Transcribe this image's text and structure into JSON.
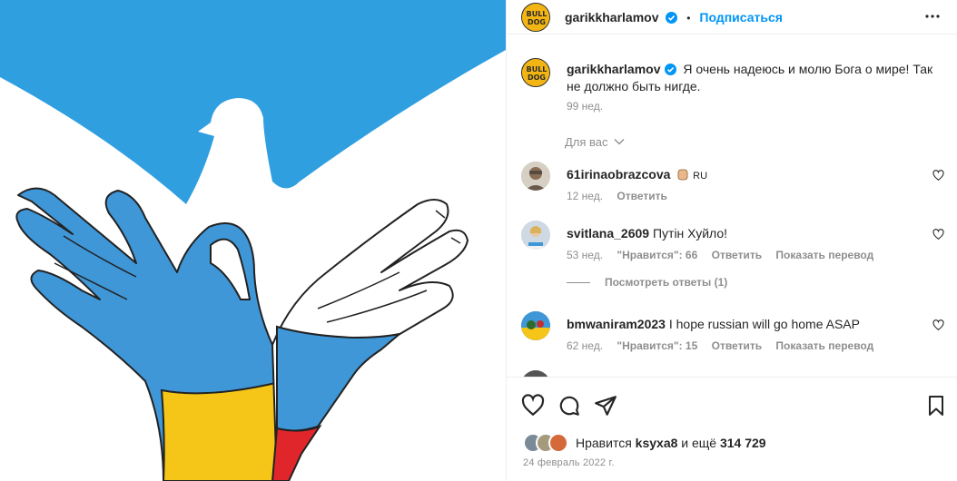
{
  "post": {
    "username": "garikkharlamov",
    "follow_label": "Подписаться",
    "separator": "•"
  },
  "caption": {
    "username": "garikkharlamov",
    "text": "Я очень надеюсь и молю Бога о мире! Так не должно быть нигде.",
    "age": "99 нед."
  },
  "filter": {
    "label": "Для вас"
  },
  "comments": [
    {
      "username": "61irinaobrazcova",
      "text": "RU",
      "age": "12 нед.",
      "likes": "",
      "reply_label": "Ответить",
      "translate_label": ""
    },
    {
      "username": "svitlana_2609",
      "text": "Путін Хуйло!",
      "age": "53 нед.",
      "likes": "\"Нравится\": 66",
      "reply_label": "Ответить",
      "translate_label": "Показать перевод"
    },
    {
      "username": "bmwaniram2023",
      "text": "I hope russian will go home ASAP",
      "age": "62 нед.",
      "likes": "\"Нравится\": 15",
      "reply_label": "Ответить",
      "translate_label": "Показать перевод"
    }
  ],
  "view_replies": "Посмотреть ответы (1)",
  "likes": {
    "prefix": "Нравится",
    "user": "ksyxa8",
    "and_more": "и ещё",
    "count": "314 729"
  },
  "date": "24 февраль 2022 г.",
  "colors": {
    "sky": "#2f9fe0",
    "blue_hand": "#3f97d8",
    "yellow_hand": "#f5c518",
    "red_hand": "#e0262b",
    "white_hand": "#ffffff",
    "link": "#0095f6",
    "verified": "#0095f6"
  },
  "icons": [
    "more-icon",
    "verified-icon",
    "chevron-down-icon",
    "heart-icon",
    "comment-icon",
    "share-icon",
    "bookmark-icon"
  ]
}
